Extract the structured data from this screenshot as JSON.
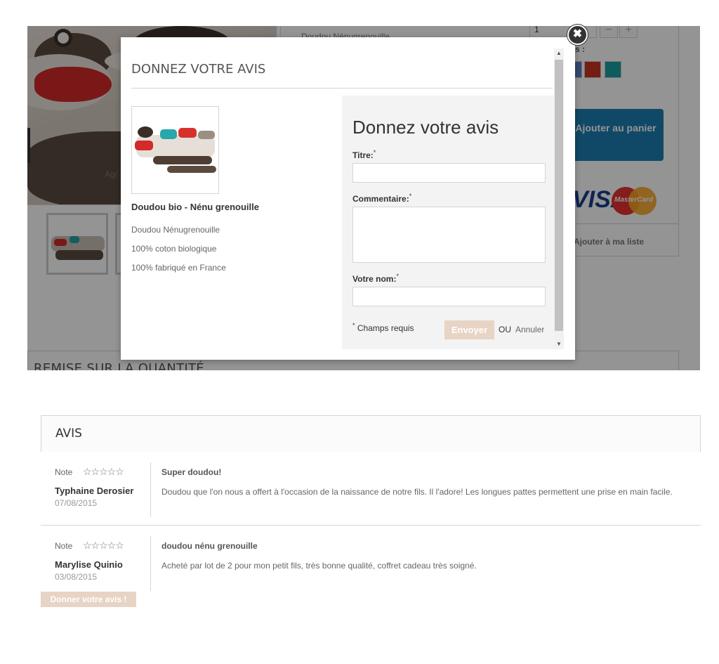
{
  "background": {
    "product_name_fragment": "Doudou Nénugrenouille",
    "partial_label": "Agr",
    "quantity": "1",
    "minus": "−",
    "plus": "+",
    "colors_label_fragment": "s :",
    "swatch_colors": [
      "#5a7ec2",
      "#c8341f",
      "#199fa0"
    ],
    "add_to_cart": "Ajouter au panier",
    "visa": "VISA",
    "mastercard": "MasterCard",
    "wishlist": "Ajouter à ma liste",
    "remise": "REMISE SUR LA QUANTITÉ"
  },
  "modal": {
    "close_icon": "✖",
    "title": "DONNEZ VOTRE AVIS",
    "product": {
      "name": "Doudou bio - Nénu grenouille",
      "lines": [
        "Doudou Nénugrenouille",
        "100% coton biologique",
        "100% fabriqué en France"
      ]
    },
    "form": {
      "heading": "Donnez votre avis",
      "title_label": "Titre:",
      "comment_label": "Commentaire:",
      "name_label": "Votre nom:",
      "required_mark": "*",
      "required_note": "Champs requis",
      "send_button": "Envoyer",
      "or_text": "OU",
      "cancel_link": "Annuler"
    }
  },
  "reviews": {
    "heading": "AVIS",
    "note_label": "Note",
    "stars": "☆☆☆☆☆",
    "items": [
      {
        "author": "Typhaine Derosier",
        "date": "07/08/2015",
        "title": "Super doudou!",
        "text": "Doudou que l'on nous a offert à l'occasion de la naissance de notre fils. Il l'adore! Les longues pattes permettent une prise en main facile."
      },
      {
        "author": "Marylise Quinio",
        "date": "03/08/2015",
        "title": "doudou nénu grenouille",
        "text": "Acheté par lot de 2 pour mon petit fils, très bonne qualité, coffret cadeau très soigné."
      }
    ],
    "give_review_button": "Donner votre avis !"
  }
}
